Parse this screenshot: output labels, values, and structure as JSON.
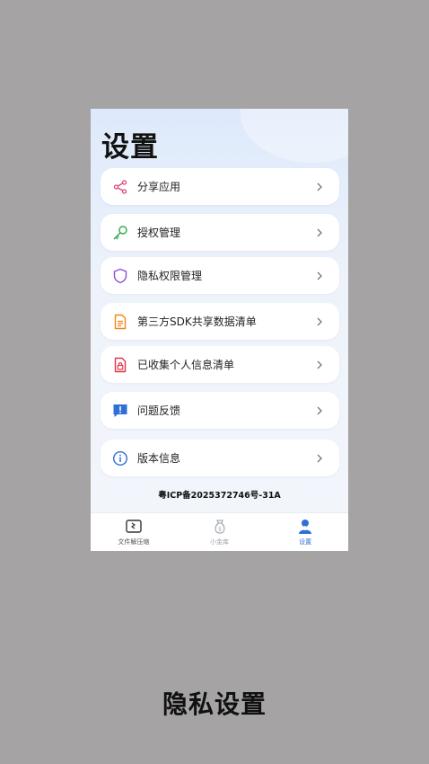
{
  "page": {
    "title": "设置"
  },
  "menu": [
    {
      "label": "分享应用",
      "icon": "share-icon",
      "color": "#e2457a"
    },
    {
      "label": "授权管理",
      "icon": "key-icon",
      "color": "#2ea84f"
    },
    {
      "label": "隐私权限管理",
      "icon": "shield-icon",
      "color": "#8a4fd6"
    },
    {
      "label": "第三方SDK共享数据清单",
      "icon": "document-icon",
      "color": "#f0861e"
    },
    {
      "label": "已收集个人信息清单",
      "icon": "lock-document-icon",
      "color": "#e0354a"
    },
    {
      "label": "问题反馈",
      "icon": "feedback-icon",
      "color": "#2f6fd6"
    },
    {
      "label": "版本信息",
      "icon": "info-icon",
      "color": "#2f6fd6"
    }
  ],
  "footer": {
    "icp": "粤ICP备2025372746号-31A"
  },
  "tabbar": {
    "tabs": [
      {
        "label": "文件解压缩",
        "icon": "zip-file-icon",
        "state": "normal"
      },
      {
        "label": "小金库",
        "icon": "money-bag-icon",
        "state": "dim"
      },
      {
        "label": "设置",
        "icon": "user-icon",
        "state": "active"
      }
    ]
  },
  "caption": "隐私设置",
  "colors": {
    "accent": "#2f6fd6",
    "background": "#a5a3a4"
  }
}
